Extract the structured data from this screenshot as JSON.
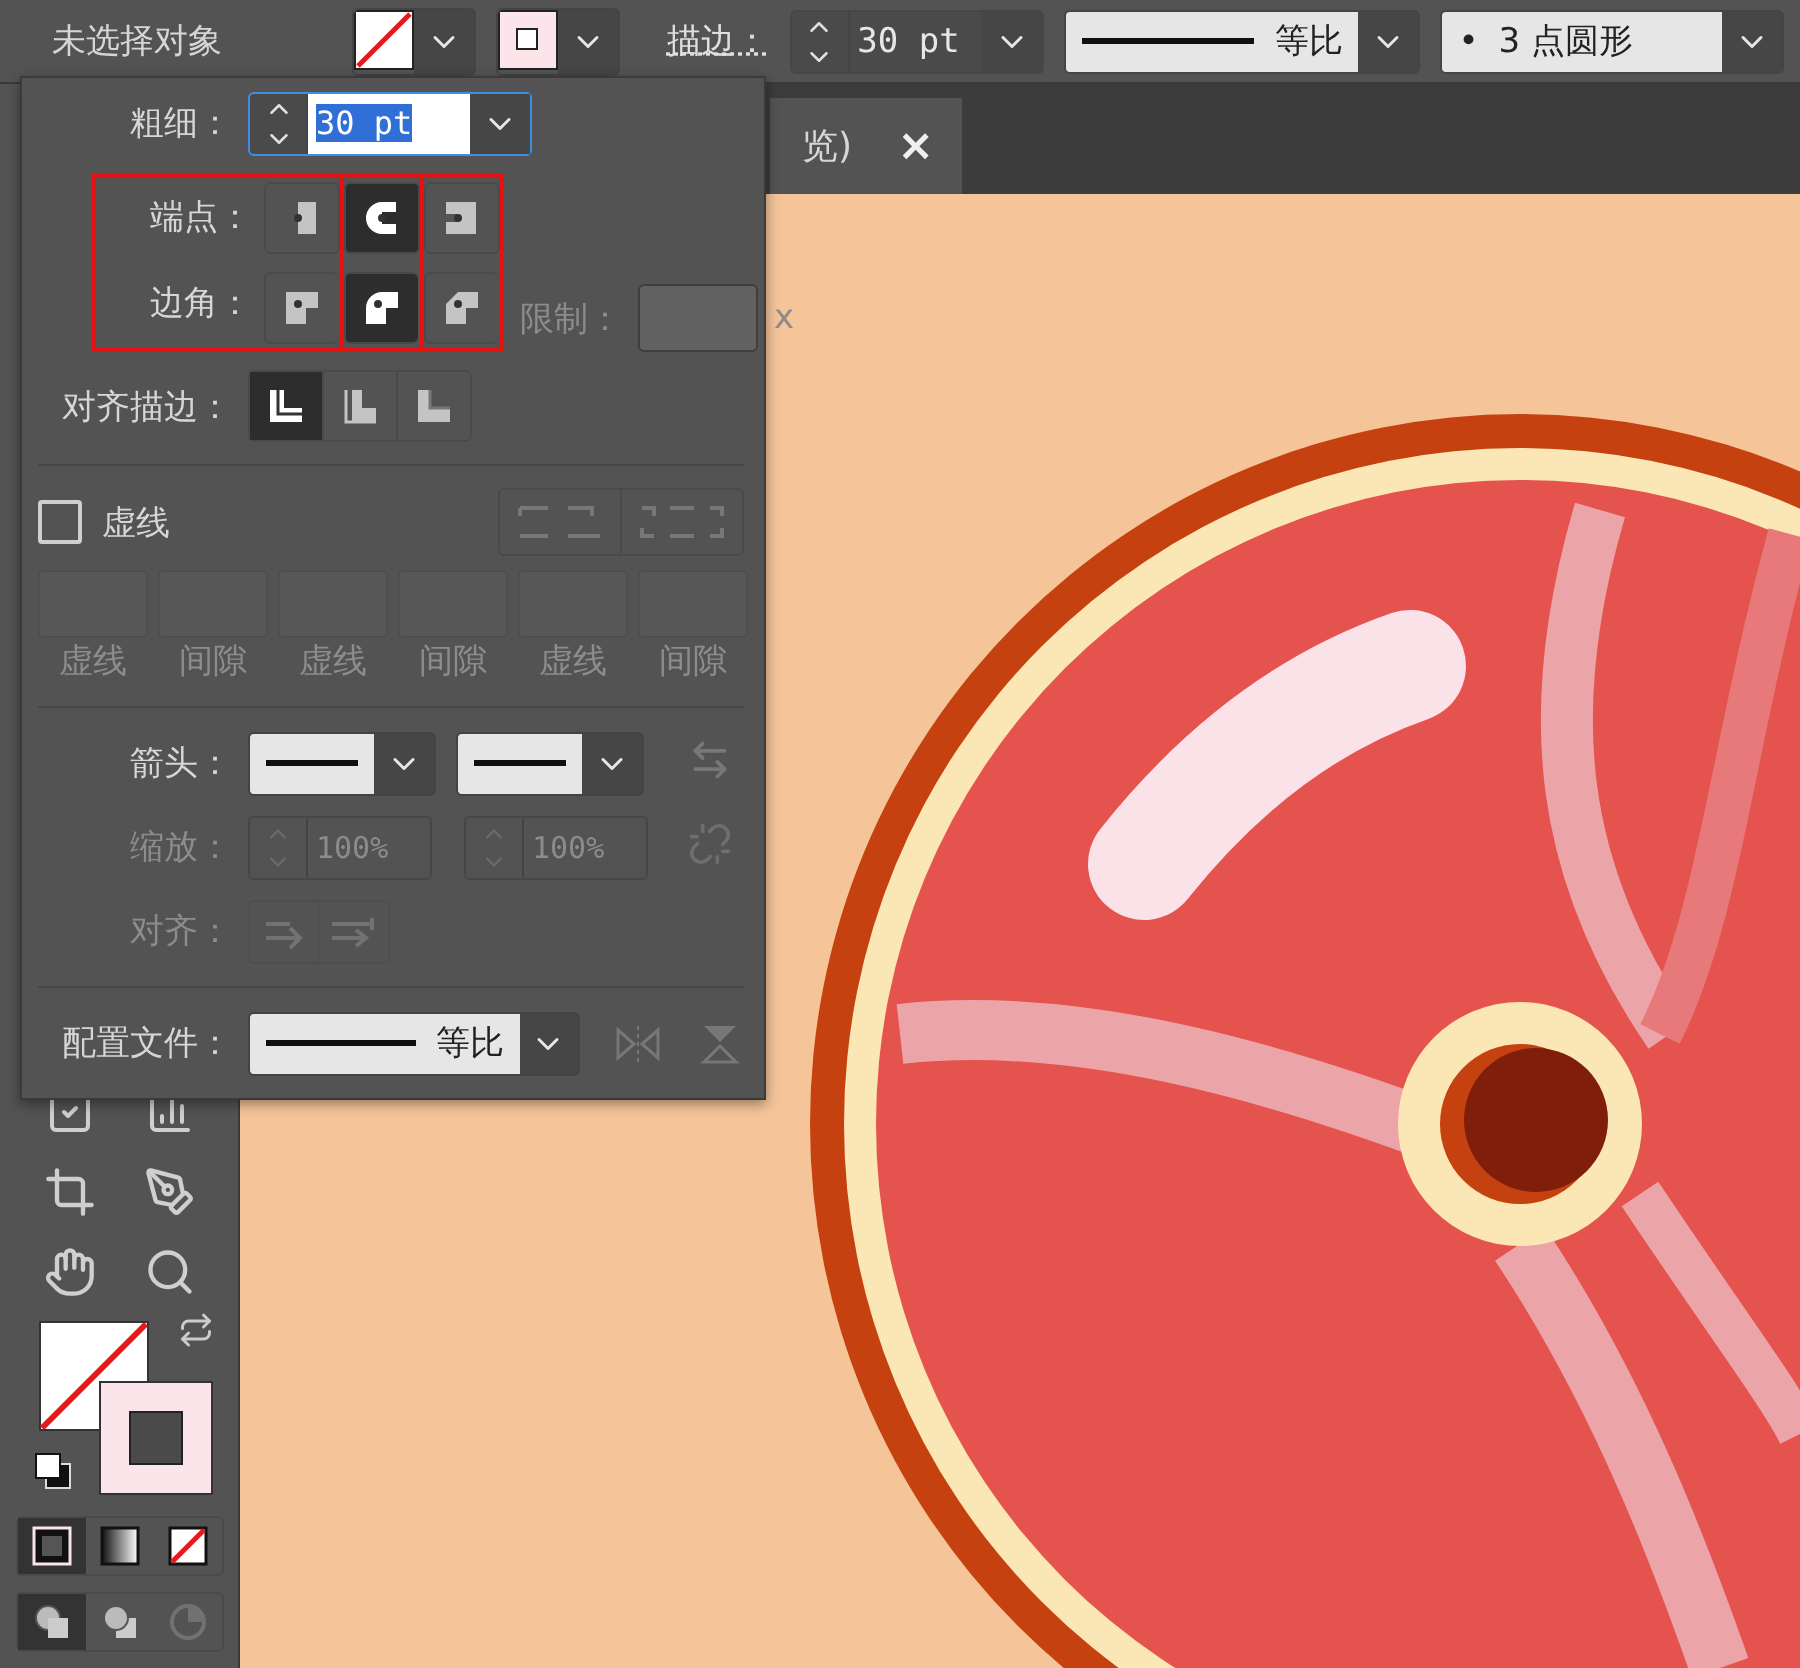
{
  "control_bar": {
    "selection": "未选择对象",
    "fill_swatch": {
      "kind": "none"
    },
    "stroke_swatch": {
      "kind": "color"
    },
    "stroke_label": "描边：",
    "stroke_weight": "30 pt",
    "profile": "等比",
    "brush": {
      "bullet": "•",
      "name": "3 点圆形"
    }
  },
  "document_tab": {
    "title": "览)",
    "close": "×"
  },
  "stroke_panel": {
    "weight": {
      "label": "粗细：",
      "value": "30 pt",
      "text_selected": true
    },
    "cap": {
      "label": "端点：",
      "options": [
        {
          "kind": "butt",
          "selected": false
        },
        {
          "kind": "round",
          "selected": true
        },
        {
          "kind": "projecting",
          "selected": false
        }
      ]
    },
    "corner": {
      "label": "边角：",
      "options": [
        {
          "kind": "miter",
          "selected": false
        },
        {
          "kind": "round",
          "selected": true
        },
        {
          "kind": "bevel",
          "selected": false
        }
      ],
      "limit": {
        "label": "限制：",
        "suffix": "x",
        "disabled": true
      }
    },
    "align": {
      "label": "对齐描边：",
      "options": [
        {
          "kind": "center",
          "selected": true
        },
        {
          "kind": "inside",
          "selected": false
        },
        {
          "kind": "outside",
          "selected": false
        }
      ]
    },
    "dashed": {
      "label": "虚线",
      "checked": false,
      "fields": [
        {
          "label": "虚线",
          "disabled": true
        },
        {
          "label": "间隙",
          "disabled": true
        },
        {
          "label": "虚线",
          "disabled": true
        },
        {
          "label": "间隙",
          "disabled": true
        },
        {
          "label": "虚线",
          "disabled": true
        },
        {
          "label": "间隙",
          "disabled": true
        }
      ]
    },
    "arrows": {
      "label": "箭头："
    },
    "scale": {
      "label": "缩放：",
      "values": [
        "100%",
        "100%"
      ],
      "disabled": true
    },
    "arrow_align": {
      "label": "对齐：",
      "disabled": true
    },
    "profile": {
      "label": "配置文件：",
      "value": "等比"
    }
  },
  "toolbar": {
    "fill": {
      "kind": "none"
    },
    "stroke": {
      "kind": "color"
    },
    "color_modes": [
      {
        "kind": "color",
        "selected": true
      },
      {
        "kind": "gradient",
        "selected": false
      },
      {
        "kind": "none",
        "selected": false
      }
    ],
    "draw_modes": [
      {
        "kind": "normal",
        "selected": true,
        "disabled": false
      },
      {
        "kind": "behind",
        "selected": false,
        "disabled": false
      },
      {
        "kind": "inside",
        "selected": false,
        "disabled": true
      }
    ]
  }
}
